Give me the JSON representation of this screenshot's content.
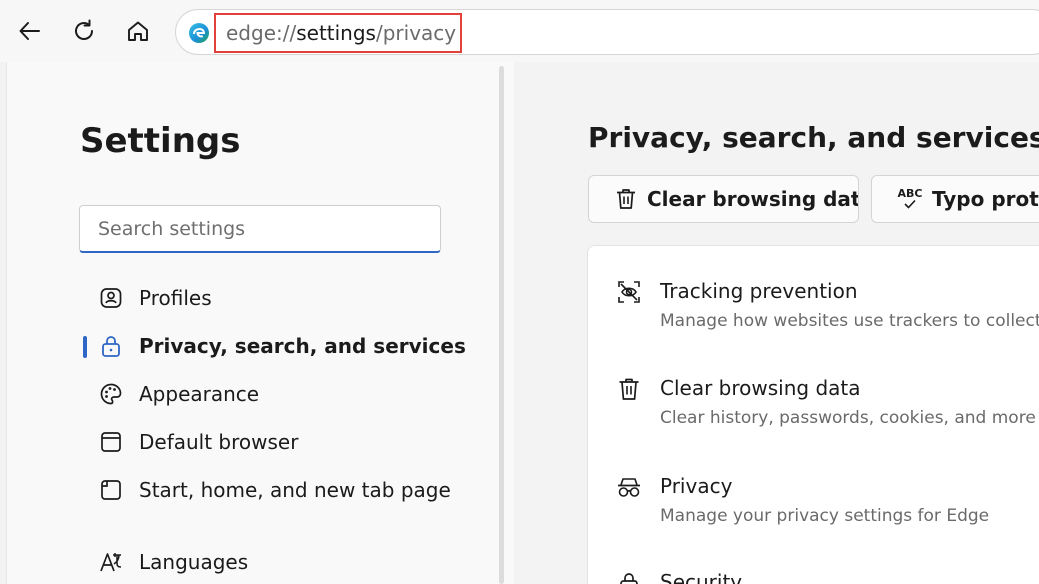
{
  "browser": {
    "address": {
      "scheme": "edge://",
      "host": "settings",
      "path": "/privacy"
    }
  },
  "sidebar": {
    "title": "Settings",
    "search_placeholder": "Search settings",
    "items": [
      {
        "label": "Profiles",
        "icon": "profiles-icon"
      },
      {
        "label": "Privacy, search, and services",
        "icon": "lock-icon",
        "active": true
      },
      {
        "label": "Appearance",
        "icon": "palette-icon"
      },
      {
        "label": "Default browser",
        "icon": "browser-window-icon"
      },
      {
        "label": "Start, home, and new tab page",
        "icon": "start-page-icon"
      },
      {
        "label": "Languages",
        "icon": "languages-icon"
      }
    ]
  },
  "main": {
    "title": "Privacy, search, and services",
    "actions": [
      {
        "label": "Clear browsing data",
        "icon": "trash-icon"
      },
      {
        "label": "Typo protec",
        "icon": "abc-check-icon",
        "icon_text": "ABC"
      }
    ],
    "rows": [
      {
        "title": "Tracking prevention",
        "desc": "Manage how websites use trackers to collect inf",
        "icon": "tracking-prevention-icon"
      },
      {
        "title": "Clear browsing data",
        "desc": "Clear history, passwords, cookies, and more fron",
        "icon": "trash-icon"
      },
      {
        "title": "Privacy",
        "desc": "Manage your privacy settings for Edge",
        "icon": "incognito-icon"
      },
      {
        "title": "Security",
        "desc": "",
        "icon": "security-lock-icon"
      }
    ]
  },
  "colors": {
    "accent": "#2f67c6",
    "highlight_border": "#e0413a"
  }
}
